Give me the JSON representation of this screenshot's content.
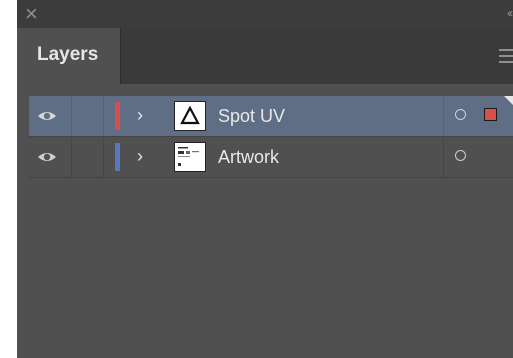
{
  "panel": {
    "title": "Layers",
    "icons": {
      "close": "close-icon",
      "collapse": "double-chevron-left-icon",
      "menu": "hamburger-menu-icon"
    }
  },
  "layers": [
    {
      "name": "Spot UV",
      "visible": true,
      "selected": true,
      "color": "#d8504b",
      "thumbnail": "triangle-icon",
      "selection_indicator": "#d8504b"
    },
    {
      "name": "Artwork",
      "visible": true,
      "selected": false,
      "color": "#5a78bf",
      "thumbnail": "artwork-thumbnail",
      "selection_indicator": ""
    }
  ],
  "colors": {
    "panel_bg": "#505050",
    "selected_row": "#5f6e85",
    "text": "#e8e8e8"
  }
}
